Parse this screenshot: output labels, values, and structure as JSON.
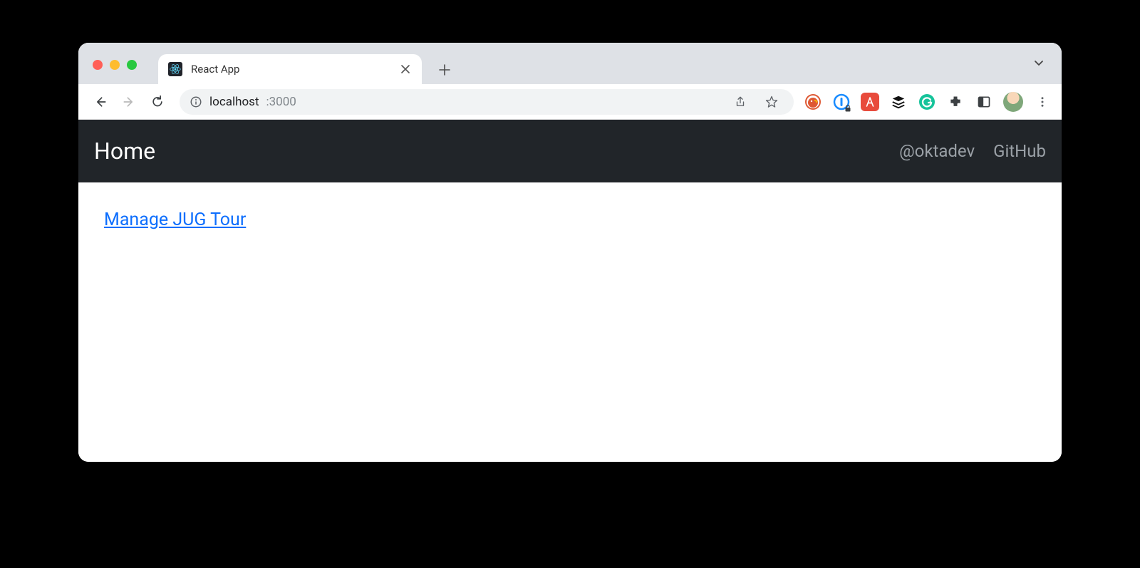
{
  "browser": {
    "tab_title": "React App",
    "url_host": "localhost",
    "url_port": ":3000",
    "icons": {
      "close": "close",
      "new_tab": "plus",
      "back": "arrow-left",
      "forward": "arrow-right",
      "reload": "reload",
      "info": "info",
      "share": "share",
      "star": "star",
      "puzzle": "extensions",
      "reader": "reader",
      "menu": "menu",
      "tabs_chevron": "chevron-down"
    },
    "extensions": [
      {
        "name": "duckduckgo",
        "bg": "#ffffff",
        "fg": "#de5833"
      },
      {
        "name": "onepassword",
        "bg": "#ffffff",
        "fg": "#1a8cff"
      },
      {
        "name": "asciidoctor",
        "bg": "#e84b3c",
        "fg": "#ffffff"
      },
      {
        "name": "buffer",
        "bg": "#ffffff",
        "fg": "#111111"
      },
      {
        "name": "grammarly",
        "bg": "#15c39a",
        "fg": "#ffffff"
      }
    ]
  },
  "app": {
    "brand": "Home",
    "nav_links": [
      {
        "label": "@oktadev"
      },
      {
        "label": "GitHub"
      }
    ],
    "main_link": "Manage JUG Tour"
  }
}
